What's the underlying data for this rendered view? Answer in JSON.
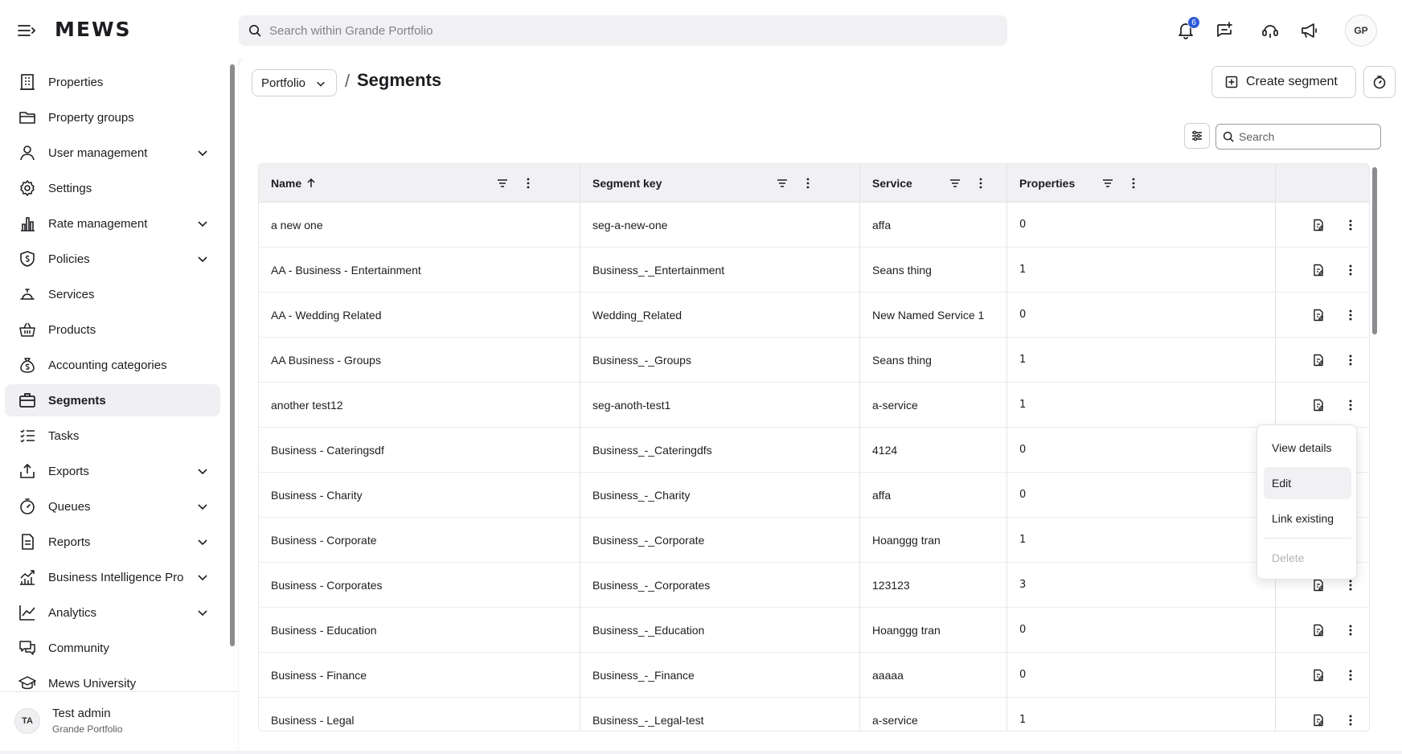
{
  "header": {
    "logo": "MEWS",
    "search_placeholder": "Search within Grande Portfolio",
    "notification_count": "6",
    "user_initials": "GP",
    "icons": [
      "menu-icon",
      "bell-icon",
      "sparkle-message-icon",
      "support-icon",
      "megaphone-icon"
    ]
  },
  "sidebar": {
    "items": [
      {
        "label": "Properties",
        "icon": "building-icon"
      },
      {
        "label": "Property groups",
        "icon": "folder-icon"
      },
      {
        "label": "User management",
        "icon": "user-icon",
        "expandable": true
      },
      {
        "label": "Settings",
        "icon": "gear-icon"
      },
      {
        "label": "Rate management",
        "icon": "bar-chart-icon",
        "expandable": true
      },
      {
        "label": "Policies",
        "icon": "shield-icon",
        "expandable": true
      },
      {
        "label": "Services",
        "icon": "service-bell-icon"
      },
      {
        "label": "Products",
        "icon": "basket-icon"
      },
      {
        "label": "Accounting categories",
        "icon": "money-bag-icon"
      },
      {
        "label": "Segments",
        "icon": "briefcase-icon",
        "active": true
      },
      {
        "label": "Tasks",
        "icon": "task-list-icon"
      },
      {
        "label": "Exports",
        "icon": "export-icon",
        "expandable": true
      },
      {
        "label": "Queues",
        "icon": "stopwatch-icon",
        "expandable": true
      },
      {
        "label": "Reports",
        "icon": "report-icon",
        "expandable": true
      },
      {
        "label": "Business Intelligence Pro",
        "icon": "trend-chart-icon",
        "expandable": true
      },
      {
        "label": "Analytics",
        "icon": "line-chart-icon",
        "expandable": true
      },
      {
        "label": "Community",
        "icon": "chat-icon"
      },
      {
        "label": "Mews University",
        "icon": "graduation-cap-icon"
      }
    ],
    "user": {
      "initials": "TA",
      "name": "Test admin",
      "org": "Grande Portfolio"
    }
  },
  "page": {
    "breadcrumb_root": "Portfolio",
    "breadcrumb_sep": "/",
    "title": "Segments",
    "create_label": "Create segment",
    "search_placeholder": "Search"
  },
  "table": {
    "columns": [
      "Name",
      "Segment key",
      "Service",
      "Properties"
    ],
    "rows": [
      {
        "name": "a new one",
        "key": "seg-a-new-one",
        "service": "affa",
        "properties": "0"
      },
      {
        "name": "AA - Business - Entertainment",
        "key": "Business_-_Entertainment",
        "service": "Seans thing",
        "properties": "1"
      },
      {
        "name": "AA - Wedding Related",
        "key": "Wedding_Related",
        "service": "New Named Service 1",
        "properties": "0"
      },
      {
        "name": "AA Business - Groups",
        "key": "Business_-_Groups",
        "service": "Seans thing",
        "properties": "1"
      },
      {
        "name": "another test12",
        "key": "seg-anoth-test1",
        "service": "a-service",
        "properties": "1"
      },
      {
        "name": "Business - Cateringsdf",
        "key": "Business_-_Cateringdfs",
        "service": "4124",
        "properties": "0"
      },
      {
        "name": "Business - Charity",
        "key": "Business_-_Charity",
        "service": "affa",
        "properties": "0"
      },
      {
        "name": "Business - Corporate",
        "key": "Business_-_Corporate",
        "service": "Hoanggg tran",
        "properties": "1"
      },
      {
        "name": "Business - Corporates",
        "key": "Business_-_Corporates",
        "service": "123123",
        "properties": "3"
      },
      {
        "name": "Business - Education",
        "key": "Business_-_Education",
        "service": "Hoanggg tran",
        "properties": "0"
      },
      {
        "name": "Business - Finance",
        "key": "Business_-_Finance",
        "service": "aaaaa",
        "properties": "0"
      },
      {
        "name": "Business - Legal",
        "key": "Business_-_Legal-test",
        "service": "a-service",
        "properties": "1"
      }
    ]
  },
  "row_menu": {
    "items": [
      {
        "label": "View details",
        "state": "normal"
      },
      {
        "label": "Edit",
        "state": "hover"
      },
      {
        "label": "Link existing",
        "state": "normal"
      },
      {
        "label": "Delete",
        "state": "disabled"
      }
    ]
  },
  "colors": {
    "accent": "#2f5bd9",
    "active_nav": "#f0f0f2",
    "header_row": "#f1f1f3"
  }
}
